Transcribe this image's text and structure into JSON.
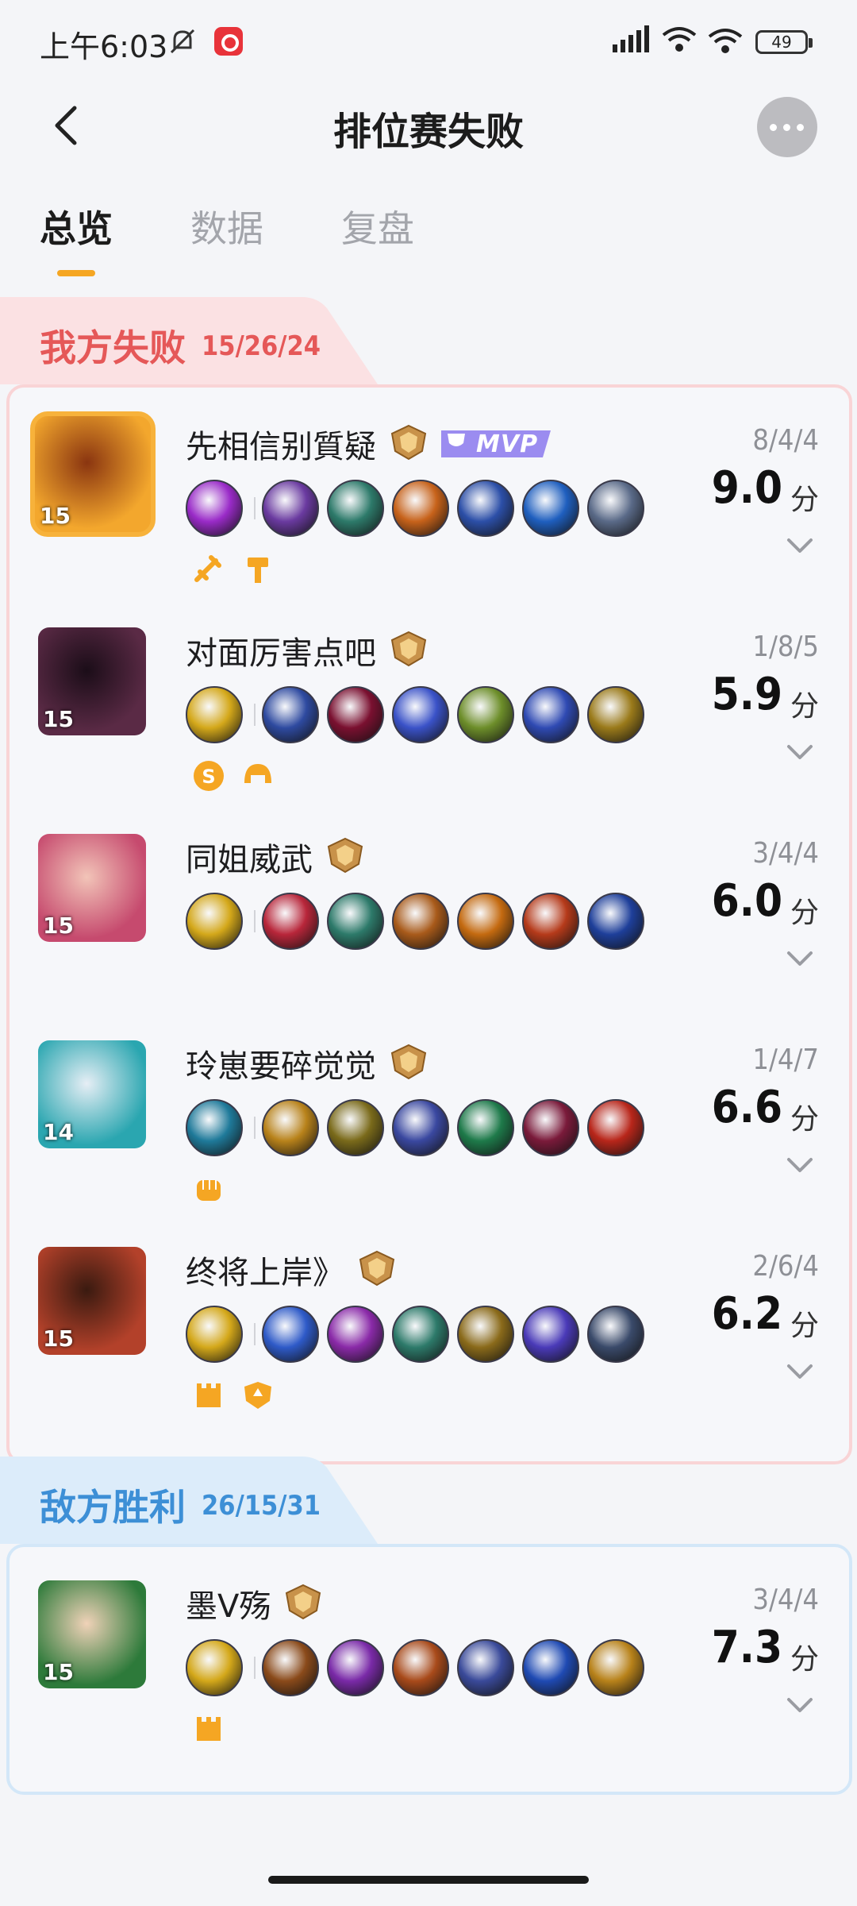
{
  "status": {
    "time": "上午6:03",
    "battery": "49"
  },
  "header": {
    "title": "排位赛失败"
  },
  "tabs": [
    {
      "label": "总览",
      "active": true
    },
    {
      "label": "数据",
      "active": false
    },
    {
      "label": "复盘",
      "active": false
    }
  ],
  "teams": [
    {
      "label": "我方失败",
      "score": "15/26/24",
      "color": "#e55858",
      "players": [
        {
          "name": "先相信别質疑",
          "level": "15",
          "kda": "8/4/4",
          "score": "9.0",
          "unit": "分",
          "mvp": "MVP",
          "hero_colors": [
            "#f3a72d",
            "#8a3510"
          ],
          "items": [
            "#9a2bc8",
            "#6a3aa0",
            "#2d7a6a",
            "#c7621a",
            "#2c4fa8",
            "#1f5fbf",
            "#5a6a88"
          ],
          "badges": [
            "sword-icon",
            "hammer-icon"
          ]
        },
        {
          "name": "对面厉害点吧",
          "level": "15",
          "kda": "1/8/5",
          "score": "5.9",
          "unit": "分",
          "hero_colors": [
            "#5a2a45",
            "#1b0d18"
          ],
          "items": [
            "#d4a81a",
            "#2e4aa0",
            "#7a1030",
            "#3a52c8",
            "#6d8e2a",
            "#2f4ab3",
            "#9a7a1a"
          ],
          "badges": [
            "coin-icon",
            "helmet-icon"
          ]
        },
        {
          "name": "同姐威武",
          "level": "15",
          "kda": "3/4/4",
          "score": "6.0",
          "unit": "分",
          "hero_colors": [
            "#c64a6e",
            "#f2c4b8"
          ],
          "items": [
            "#d4a81a",
            "#b8263a",
            "#2d7a6a",
            "#a85a1a",
            "#c46a10",
            "#b53a1a",
            "#1e3f9a"
          ],
          "badges": []
        },
        {
          "name": "玲崽要碎觉觉",
          "level": "14",
          "kda": "1/4/7",
          "score": "6.6",
          "unit": "分",
          "hero_colors": [
            "#2aa6b0",
            "#e6eef5"
          ],
          "items": [
            "#1f7a9a",
            "#b8821a",
            "#7a6a1a",
            "#3a48a0",
            "#1e7a4a",
            "#7a1a3a",
            "#b8261a"
          ],
          "badges": [
            "fist-icon"
          ]
        },
        {
          "name": "终将上岸》",
          "level": "15",
          "kda": "2/6/4",
          "score": "6.2",
          "unit": "分",
          "hero_colors": [
            "#b3412a",
            "#3a1a10"
          ],
          "items": [
            "#d4a81a",
            "#2e5ac8",
            "#8a2aa8",
            "#2d7a6a",
            "#8a6a1a",
            "#4a3ab8",
            "#3a4a6a"
          ],
          "badges": [
            "tower-icon",
            "shield-icon"
          ]
        }
      ]
    },
    {
      "label": "敌方胜利",
      "score": "26/15/31",
      "color": "#3d8fd6",
      "players": [
        {
          "name": "墨V殇",
          "level": "15",
          "kda": "3/4/4",
          "score": "7.3",
          "unit": "分",
          "hero_colors": [
            "#2d7a3a",
            "#f0d2b8"
          ],
          "items": [
            "#d4a81a",
            "#8a4a1a",
            "#7a2aa8",
            "#a84a1a",
            "#3a4a9a",
            "#1f4ab3",
            "#b8821a"
          ],
          "badges": [
            "tower-icon"
          ]
        }
      ]
    }
  ]
}
